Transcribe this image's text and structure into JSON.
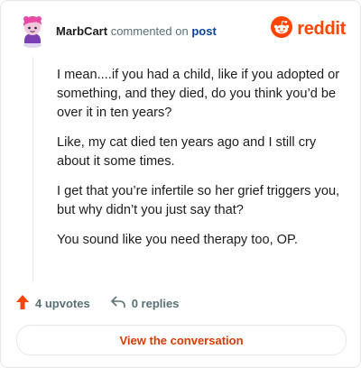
{
  "comment": {
    "author": "MarbCart",
    "action": "commented on",
    "target": "post",
    "paragraphs": [
      "I mean....if you had a child, like if you adopted or something, and they died, do you think you’d be over it in ten years?",
      "Like, my cat died ten years ago and I still cry about it some times.",
      "I get that you’re infertile so her grief triggers you, but why didn’t you just say that?",
      "You sound like you need therapy too, OP."
    ],
    "upvotes_label": "4 upvotes",
    "replies_label": "0 replies"
  },
  "brand": {
    "name": "reddit",
    "color": "#ff4500"
  },
  "cta": {
    "label": "View the conversation"
  },
  "icons": {
    "avatar": "avatar",
    "logo": "reddit-snoo-icon",
    "upvote": "upvote-arrow-icon",
    "reply": "reply-arrow-icon"
  }
}
